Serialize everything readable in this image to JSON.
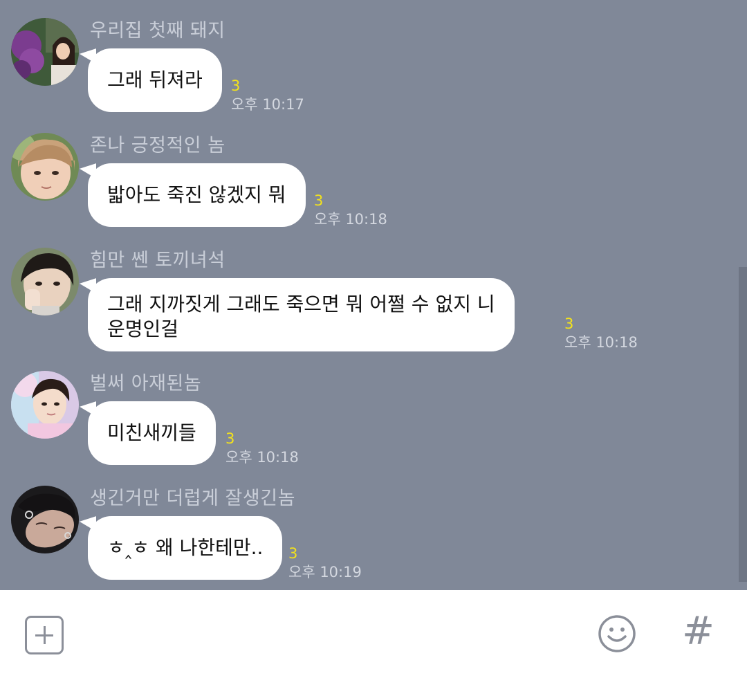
{
  "messages": [
    {
      "sender": "우리집 첫째 돼지",
      "lines": [
        "그래 뒤져라"
      ],
      "unread": "3",
      "time": "오후 10:17"
    },
    {
      "sender": "존나 긍정적인 놈",
      "lines": [
        "밟아도 죽진 않겠지 뭐"
      ],
      "unread": "3",
      "time": "오후 10:18"
    },
    {
      "sender": "힘만 쎈 토끼녀석",
      "lines": [
        "그래 지까짓게 그래도 죽으면 뭐 어쩔 수 없지 니",
        "운명인걸"
      ],
      "unread": "3",
      "time": "오후 10:18"
    },
    {
      "sender": "벌써 아재된놈",
      "lines": [
        "미친새끼들"
      ],
      "unread": "3",
      "time": "오후 10:18"
    },
    {
      "sender": "생긴거만 더럽게 잘생긴놈",
      "lines": [
        "ㅎ‸ㅎ 왜 나한테만.."
      ],
      "unread": "3",
      "time": "오후 10:19"
    }
  ],
  "input_bar": {
    "add_icon": "plus-square-icon",
    "emoji_icon": "smiley-icon",
    "hash_label": "#"
  },
  "colors": {
    "background": "#808898",
    "bubble": "#ffffff",
    "unread": "#f4e31a",
    "input_bar": "#ffffff"
  }
}
